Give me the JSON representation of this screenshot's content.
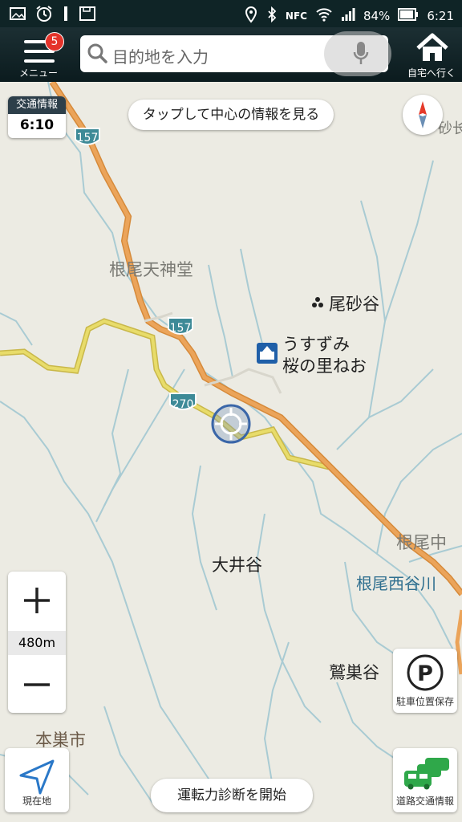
{
  "status_bar": {
    "battery": "84%",
    "time": "6:21",
    "nfc": "NFC",
    "icons": [
      "image-icon",
      "alarm-icon",
      "sim-icon",
      "save-icon",
      "location-icon",
      "bluetooth-icon",
      "wifi-icon",
      "signal-icon",
      "battery-icon"
    ]
  },
  "toolbar": {
    "menu_label": "メニュー",
    "menu_badge": "5",
    "search_placeholder": "目的地を入力",
    "home_label": "自宅へ行く"
  },
  "map": {
    "traffic_info_title": "交通情報",
    "traffic_info_time": "6:10",
    "center_info_button": "タップして中心の情報を見る",
    "scale": "480m",
    "current_location_label": "現在地",
    "drive_diagnosis_button": "運転力診断を開始",
    "parking_label": "駐車位置保存",
    "road_traffic_label": "道路交通情報",
    "parking_glyph": "P",
    "places": {
      "neo_tenjindo": "根尾天神堂",
      "neo_sunatani": "尾砂谷",
      "usuzumi_1": "うすずみ",
      "usuzumi_2": "桜の里ねお",
      "oidani": "大井谷",
      "neo_naka": "根尾中",
      "neo_nishitanigawa": "根尾西谷川",
      "wasudani": "鷲巣谷",
      "motosu_shi": "本巣市",
      "edge_partial": "砂长"
    },
    "routes": [
      "157",
      "157",
      "270"
    ],
    "colors": {
      "national_road": "#e39a4a",
      "prefectural_road": "#e3d45a",
      "river": "#a9cbd3",
      "land": "#ecebe3",
      "route_shield": "#3d8a97"
    }
  }
}
